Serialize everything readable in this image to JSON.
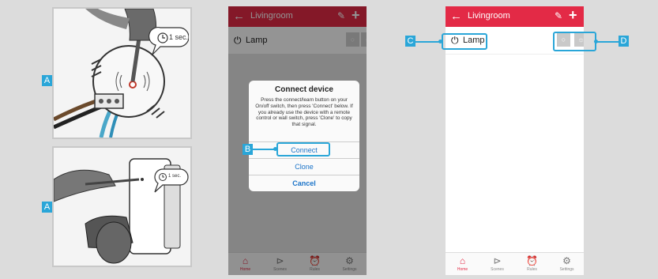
{
  "labels": {
    "A1": "A",
    "A2": "A",
    "B": "B",
    "C": "C",
    "D": "D"
  },
  "bubble_top": {
    "text": "1 sec."
  },
  "bubble_bottom": {
    "text": "1 sec."
  },
  "app": {
    "room_title": "Livingroom",
    "device_name": "Lamp",
    "tabs": [
      "Home",
      "Scenes",
      "Rules",
      "Settings"
    ]
  },
  "dialog": {
    "title": "Connect device",
    "message": "Press the connect/learn button on your On/off switch, then press 'Connect' below. If you already use the device with a remote control or wall switch, press 'Clone' to copy that signal.",
    "connect": "Connect",
    "clone": "Clone",
    "cancel": "Cancel"
  },
  "colors": {
    "header_dimmed": "#982b34",
    "header_active": "#e32a46",
    "callout": "#2aa6d8"
  },
  "icons": [
    "back-arrow-icon",
    "pencil-icon",
    "plus-icon",
    "power-icon",
    "off-icon",
    "on-icon",
    "home-icon",
    "play-icon",
    "rules-icon",
    "gear-icon"
  ]
}
